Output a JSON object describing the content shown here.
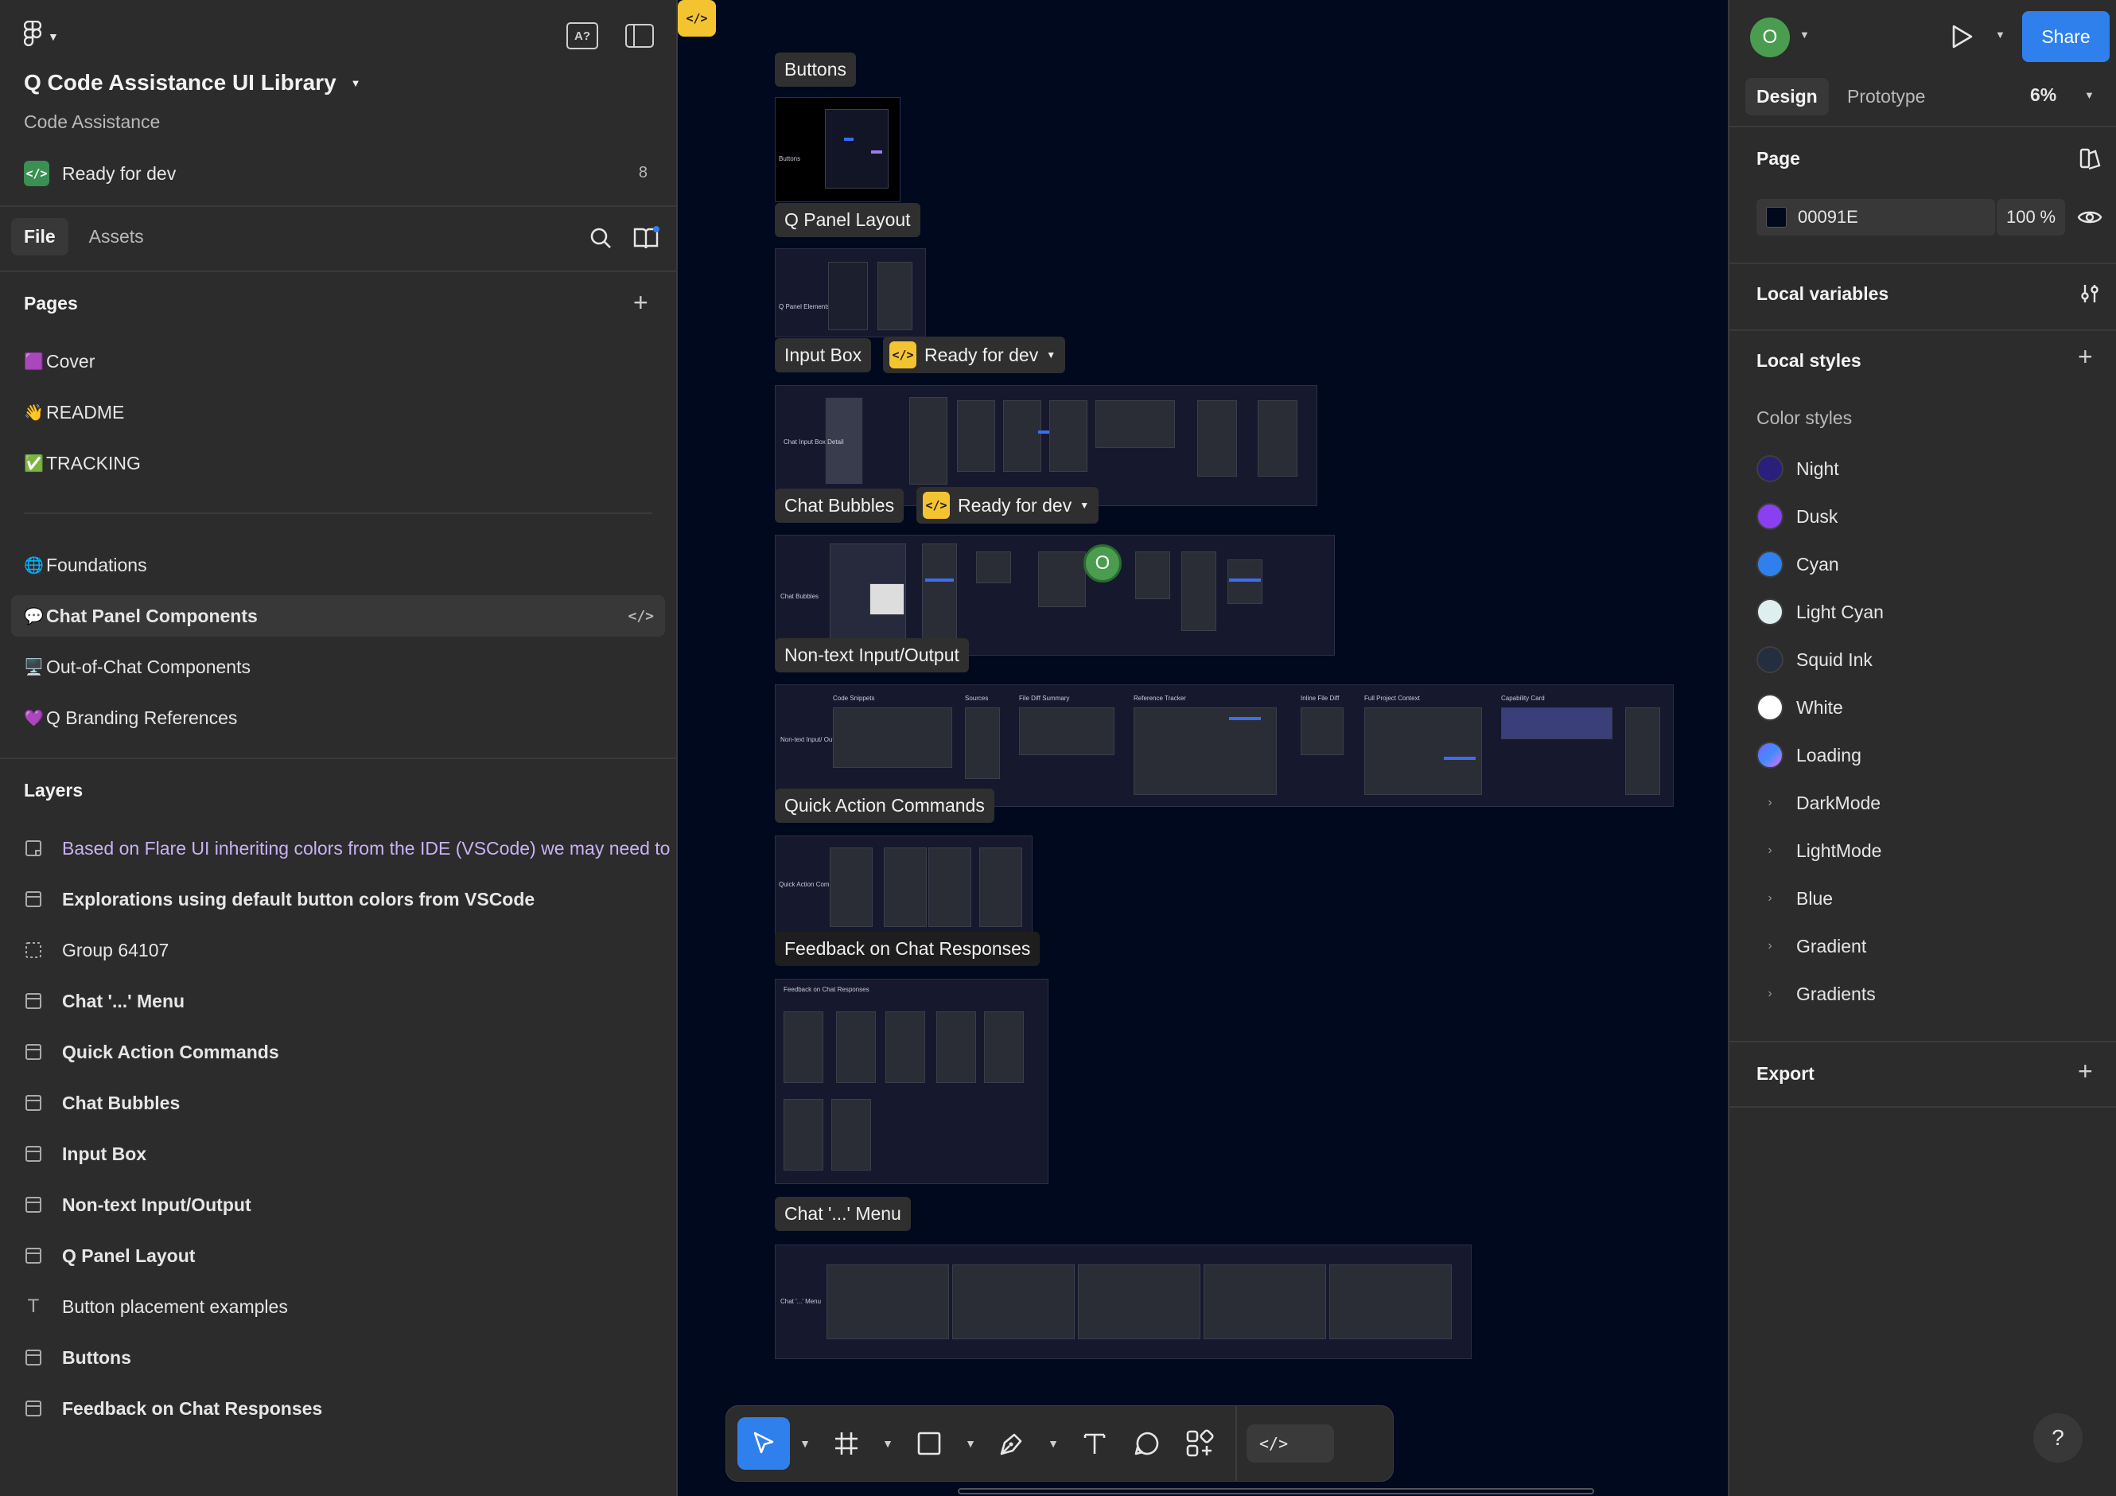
{
  "left": {
    "file_title": "Q Code Assistance UI Library",
    "file_subtitle": "Code Assistance",
    "status_label": "Ready for dev",
    "status_count": "8",
    "tabs": [
      "File",
      "Assets"
    ],
    "pages_heading": "Pages",
    "pages": [
      {
        "emoji": "🟪",
        "label": "Cover"
      },
      {
        "emoji": "👋",
        "label": "README"
      },
      {
        "emoji": "✅",
        "label": "TRACKING"
      },
      {
        "emoji": "🌐",
        "label": "Foundations"
      },
      {
        "emoji": "💬",
        "label": "Chat Panel Components"
      },
      {
        "emoji": "🖥️",
        "label": "Out-of-Chat Components"
      },
      {
        "emoji": "💜",
        "label": "Q Branding References"
      }
    ],
    "layers_heading": "Layers",
    "layers": [
      {
        "label": "Based on Flare UI inheriting colors from the IDE (VSCode) we may need to",
        "icon": "note-icon"
      },
      {
        "label": "Explorations using default button colors from VSCode",
        "icon": "frame-icon"
      },
      {
        "label": "Group 64107",
        "icon": "group-icon"
      },
      {
        "label": "Chat '...' Menu",
        "icon": "frame-icon"
      },
      {
        "label": "Quick Action Commands",
        "icon": "frame-icon"
      },
      {
        "label": "Chat Bubbles",
        "icon": "frame-icon"
      },
      {
        "label": "Input Box",
        "icon": "frame-icon"
      },
      {
        "label": "Non-text Input/Output",
        "icon": "frame-icon"
      },
      {
        "label": "Q Panel Layout",
        "icon": "frame-icon"
      },
      {
        "label": "Button placement examples",
        "icon": "text-icon"
      },
      {
        "label": "Buttons",
        "icon": "frame-icon"
      },
      {
        "label": "Feedback on Chat Responses",
        "icon": "frame-icon"
      }
    ]
  },
  "canvas": {
    "background": "#00091e",
    "sections": [
      {
        "label": "Buttons"
      },
      {
        "label": "Q Panel Layout"
      },
      {
        "label": "Input Box"
      },
      {
        "label": "Chat Bubbles"
      },
      {
        "label": "Non-text Input/Output"
      },
      {
        "label": "Quick Action Commands"
      },
      {
        "label": "Feedback on Chat Responses"
      },
      {
        "label": "Chat '...' Menu"
      }
    ],
    "ready_tag": "Ready for dev",
    "collaborator_initial": "O",
    "frame_texts": {
      "buttons": "Buttons",
      "q_panel": "Q Panel Elements",
      "input_box": "Chat Input Box Detail",
      "chat_bubbles": "Chat Bubbles",
      "nontext": "Non-text Input/ Output",
      "nontext_headers": [
        "Code Snippets",
        "Sources",
        "File Diff Summary",
        "Reference Tracker",
        "Inline File Diff",
        "Full Project Context",
        "Capability Card"
      ],
      "quick_action": "Quick Action Commands",
      "feedback": "Feedback on Chat Responses",
      "chat_menu": "Chat '...' Menu"
    }
  },
  "toolbar": {
    "tools": [
      "move-tool",
      "frame-tool",
      "shape-tool",
      "pen-tool",
      "text-tool",
      "comment-tool",
      "actions-tool",
      "dev-mode-toggle"
    ]
  },
  "right": {
    "avatar_initial": "O",
    "share_label": "Share",
    "tabs": [
      "Design",
      "Prototype"
    ],
    "zoom": "6%",
    "page_heading": "Page",
    "page_fill_hex": "00091E",
    "page_fill_opacity": "100",
    "percent_sign": "%",
    "local_variables": "Local variables",
    "local_styles": "Local styles",
    "color_styles_heading": "Color styles",
    "color_styles": [
      {
        "name": "Night",
        "color": "#2a1f7a"
      },
      {
        "name": "Dusk",
        "color": "#8a3ff0"
      },
      {
        "name": "Cyan",
        "color": "#2f80ed"
      },
      {
        "name": "Light Cyan",
        "color": "#dfeff0"
      },
      {
        "name": "Squid Ink",
        "color": "#232f3e"
      },
      {
        "name": "White",
        "color": "#ffffff"
      },
      {
        "name": "Loading",
        "color": "#7b61ff"
      }
    ],
    "style_groups": [
      "DarkMode",
      "LightMode",
      "Blue",
      "Gradient",
      "Gradients"
    ],
    "export_heading": "Export",
    "help": "?"
  }
}
